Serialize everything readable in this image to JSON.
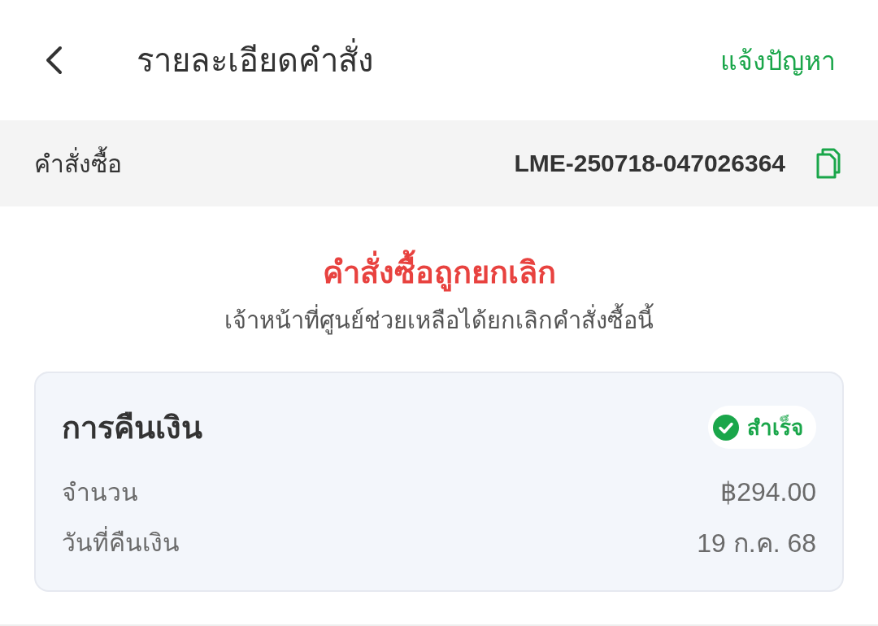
{
  "header": {
    "title": "รายละเอียดคำสั่ง",
    "action": "แจ้งปัญหา"
  },
  "order": {
    "label": "คำสั่งซื้อ",
    "number": "LME-250718-047026364"
  },
  "status": {
    "kind": "cancelled",
    "title": "คำสั่งซื้อถูกยกเลิก",
    "description": "เจ้าหน้าที่ศูนย์ช่วยเหลือได้ยกเลิกคำสั่งซื้อนี้"
  },
  "refund": {
    "title": "การคืนเงิน",
    "status": {
      "kind": "success",
      "label": "สำเร็จ"
    },
    "rows": [
      {
        "label": "จำนวน",
        "value": "฿294.00"
      },
      {
        "label": "วันที่คืนเงิน",
        "value": "19 ก.ค. 68"
      }
    ]
  }
}
